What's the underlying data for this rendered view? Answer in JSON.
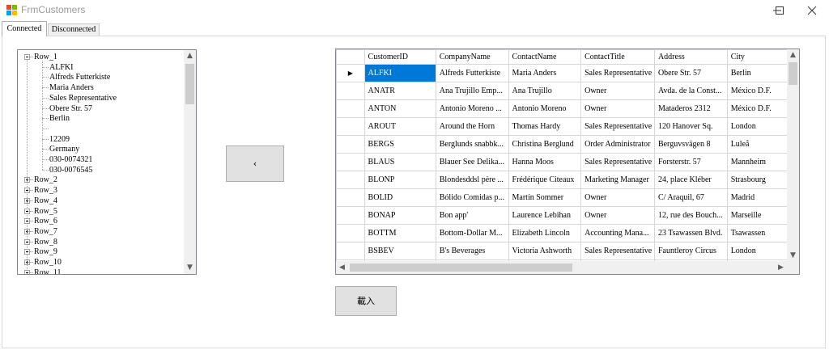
{
  "window": {
    "title": "FrmCustomers"
  },
  "tabs": [
    {
      "label": "Connected"
    },
    {
      "label": "Disconnected"
    }
  ],
  "tree": {
    "root": {
      "label": "Row_1",
      "children": [
        "ALFKI",
        "Alfreds Futterkiste",
        "Maria Anders",
        "Sales Representative",
        "Obere Str. 57",
        "Berlin",
        "",
        "12209",
        "Germany",
        "030-0074321",
        "030-0076545"
      ]
    },
    "collapsed": [
      "Row_2",
      "Row_3",
      "Row_4",
      "Row_5",
      "Row_6",
      "Row_7",
      "Row_8",
      "Row_9",
      "Row_10",
      "Row_11"
    ]
  },
  "move_button": {
    "label": "‹"
  },
  "load_button": {
    "label": "載入"
  },
  "grid": {
    "columns": [
      "CustomerID",
      "CompanyName",
      "ContactName",
      "ContactTitle",
      "Address",
      "City"
    ],
    "rows": [
      [
        "ALFKI",
        "Alfreds Futterkiste",
        "Maria Anders",
        "Sales Representative",
        "Obere Str. 57",
        "Berlin"
      ],
      [
        "ANATR",
        "Ana Trujillo Emp...",
        "Ana Trujillo",
        "Owner",
        "Avda. de la Const...",
        "México D.F."
      ],
      [
        "ANTON",
        "Antonio Moreno ...",
        "Antonio Moreno",
        "Owner",
        "Mataderos  2312",
        "México D.F."
      ],
      [
        "AROUT",
        "Around the Horn",
        "Thomas Hardy",
        "Sales Representative",
        "120 Hanover Sq.",
        "London"
      ],
      [
        "BERGS",
        "Berglunds snabbk...",
        "Christina Berglund",
        "Order Administrator",
        "Berguvsvägen  8",
        "Luleå"
      ],
      [
        "BLAUS",
        "Blauer See Delika...",
        "Hanna Moos",
        "Sales Representative",
        "Forsterstr. 57",
        "Mannheim"
      ],
      [
        "BLONP",
        "Blondesddsl père ...",
        "Frédérique Citeaux",
        "Marketing Manager",
        "24, place Kléber",
        "Strasbourg"
      ],
      [
        "BOLID",
        "Bólido Comidas p...",
        "Martín Sommer",
        "Owner",
        "C/ Araquil, 67",
        "Madrid"
      ],
      [
        "BONAP",
        "Bon app'",
        "Laurence Lebihan",
        "Owner",
        "12, rue des Bouch...",
        "Marseille"
      ],
      [
        "BOTTM",
        "Bottom-Dollar M...",
        "Elizabeth Lincoln",
        "Accounting Mana...",
        "23 Tsawassen Blvd.",
        "Tsawassen"
      ],
      [
        "BSBEV",
        "B's Beverages",
        "Victoria Ashworth",
        "Sales Representative",
        "Fauntleroy Circus",
        "London"
      ],
      [
        "",
        "",
        "",
        "",
        "",
        ""
      ]
    ],
    "current_row_indicator": "▶",
    "selected": {
      "row": 0,
      "col": 0
    }
  },
  "colors": {
    "selection": "#0078d7",
    "button_face": "#e1e1e1",
    "title_text": "#9a9a9a"
  }
}
